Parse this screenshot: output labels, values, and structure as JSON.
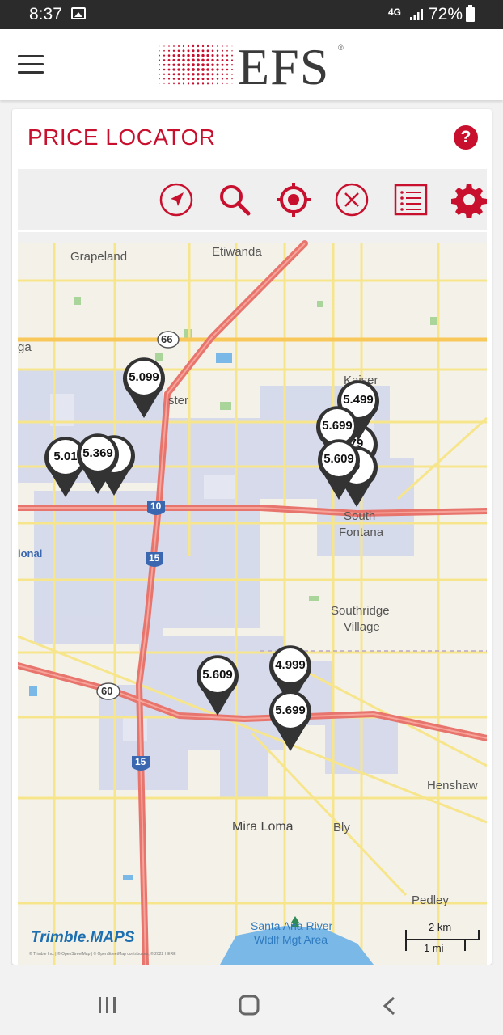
{
  "status_bar": {
    "time": "8:37",
    "network": "4G",
    "battery": "72%"
  },
  "header": {
    "logo_text": "EFS",
    "logo_reg": "®"
  },
  "page": {
    "title": "PRICE LOCATOR",
    "help_label": "?"
  },
  "toolbar": {
    "tools": [
      "navigate-icon",
      "search-icon",
      "locate-icon",
      "clear-icon",
      "list-icon",
      "settings-icon"
    ]
  },
  "map": {
    "place_labels": {
      "grapeland": "Grapeland",
      "etiwanda": "Etiwanda",
      "kaiser": "Kaiser",
      "south": "South",
      "fontana": "Fontana",
      "southridge": "Southridge",
      "village": "Village",
      "henshaw": "Henshaw",
      "mira_loma": "Mira Loma",
      "bly": "Bly",
      "pedley": "Pedley",
      "santa_ana": "Santa Ana River",
      "wldlf": "Wldlf Mgt Area",
      "ster": "ster",
      "ga": "ga",
      "ional": "ional"
    },
    "shields": {
      "r66": "66",
      "r60": "60",
      "i10": "10",
      "i15a": "15",
      "i15b": "15"
    },
    "scale": {
      "km": "2 km",
      "mi": "1 mi"
    },
    "attribution": {
      "brand": "Trimble.MAPS",
      "fine_print": "© Trimble Inc. | © OpenStreetMap | © OpenStreetMap contributors, © 2022 HERE"
    },
    "price_pins": {
      "p1": "5.099",
      "p2": "5.499",
      "p3": "5.699",
      "p4": "5.609",
      "p5": "5.01",
      "p6": "5.369",
      "p7": "9",
      "p8": "5.609",
      "p9": "4.999",
      "p10": "5.699",
      "p11": "79",
      "p12": "9"
    }
  },
  "colors": {
    "brand_red": "#c8102e",
    "freeway": "#e8756d",
    "road": "#f7e58c",
    "water": "#7ab8e8",
    "urban": "#ccd3ec"
  }
}
